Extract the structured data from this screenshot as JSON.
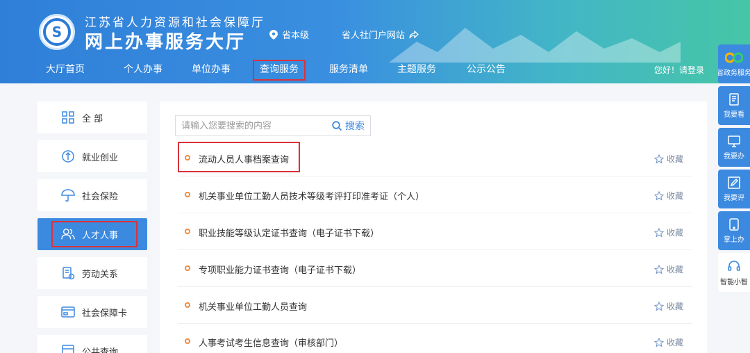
{
  "header": {
    "org_name": "江苏省人力资源和社会保障厅",
    "site_name": "网上办事服务大厅",
    "region": "省本级",
    "portal_link": "省人社门户网站",
    "logo_char": "S",
    "greeting": "您好！请登录"
  },
  "nav": [
    {
      "label": "大厅首页"
    },
    {
      "label": "个人办事"
    },
    {
      "label": "单位办事"
    },
    {
      "label": "查询服务"
    },
    {
      "label": "服务清单"
    },
    {
      "label": "主题服务"
    },
    {
      "label": "公示公告"
    }
  ],
  "sidebar": [
    {
      "label": "全 部",
      "icon": "grid-icon"
    },
    {
      "label": "就业创业",
      "icon": "employment-icon"
    },
    {
      "label": "社会保险",
      "icon": "umbrella-icon"
    },
    {
      "label": "人才人事",
      "icon": "people-icon"
    },
    {
      "label": "劳动关系",
      "icon": "document-icon"
    },
    {
      "label": "社会保障卡",
      "icon": "card-icon"
    },
    {
      "label": "公共查询",
      "icon": "query-icon"
    }
  ],
  "search": {
    "placeholder": "请输入您要搜索的内容",
    "button_label": "搜索"
  },
  "fav_label": "收藏",
  "services": [
    {
      "label": "流动人员人事档案查询"
    },
    {
      "label": "机关事业单位工勤人员技术等级考评打印准考证（个人）"
    },
    {
      "label": "职业技能等级认定证书查询（电子证书下载）"
    },
    {
      "label": "专项职业能力证书查询（电子证书下载）"
    },
    {
      "label": "机关事业单位工勤人员查询"
    },
    {
      "label": "人事考试考生信息查询（审核部门）"
    }
  ],
  "right_bar": [
    {
      "label": "省政务服务"
    },
    {
      "label": "我要看"
    },
    {
      "label": "我要办"
    },
    {
      "label": "我要评"
    },
    {
      "label": "掌上办"
    },
    {
      "label": "智能小智"
    }
  ],
  "colors": {
    "primary": "#3c8ae0",
    "highlight_border": "#d9323a",
    "bullet": "#f08a3c"
  }
}
